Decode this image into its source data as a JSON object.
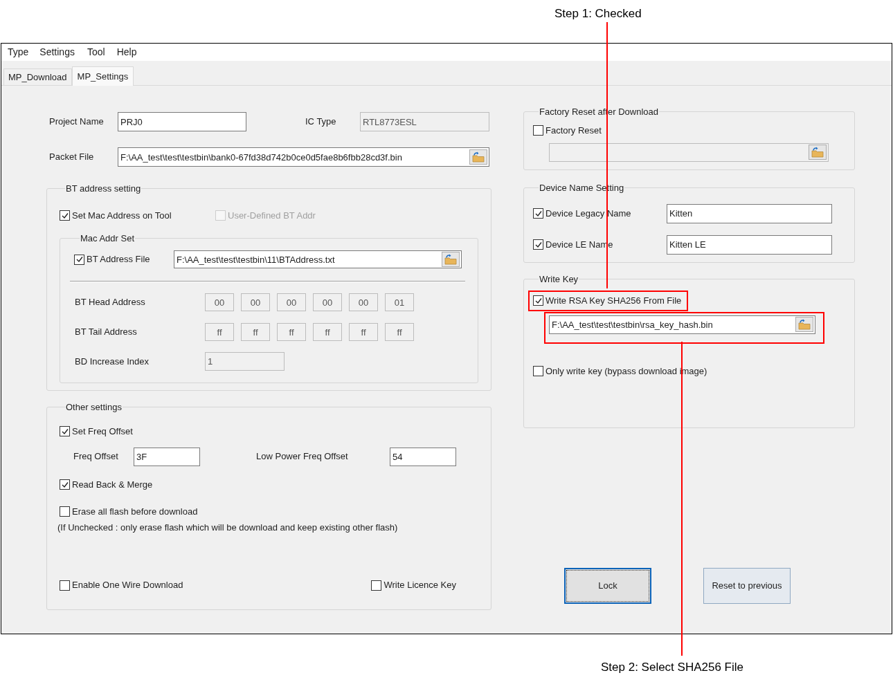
{
  "menu": [
    "Type",
    "Settings",
    "Tool",
    "Help"
  ],
  "tabs": [
    {
      "label": "MP_Download",
      "selected": false
    },
    {
      "label": "MP_Settings",
      "selected": true
    }
  ],
  "project_name": {
    "label": "Project Name",
    "value": "PRJ0",
    "disabled": false
  },
  "ic_type": {
    "label": "IC Type",
    "value": "RTL8773ESL",
    "disabled": true
  },
  "packet_file": {
    "label": "Packet File",
    "value": "F:\\AA_test\\test\\testbin\\bank0-67fd38d742b0ce0d5fae8b6fbb28cd3f.bin",
    "disabled": false,
    "browse": true
  },
  "bt_address_setting": {
    "title": "BT address setting",
    "set_mac": {
      "label": "Set Mac Address on Tool",
      "checked": true,
      "disabled": false
    },
    "user_defined": {
      "label": "User-Defined BT Addr",
      "checked": false,
      "disabled": true
    },
    "mac_addr_set": {
      "title": "Mac Addr Set",
      "bt_address_file": {
        "label": "BT Address File",
        "checked": true,
        "disabled": false
      },
      "file": {
        "value": "F:\\AA_test\\test\\testbin\\11\\BTAddress.txt",
        "disabled": false,
        "browse": true
      },
      "head": {
        "label": "BT Head Address",
        "bytes": [
          "00",
          "00",
          "00",
          "00",
          "00",
          "01"
        ],
        "disabled": true
      },
      "tail": {
        "label": "BT Tail Address",
        "bytes": [
          "ff",
          "ff",
          "ff",
          "ff",
          "ff",
          "ff"
        ],
        "disabled": true
      },
      "increase": {
        "label": "BD Increase Index",
        "value": "1",
        "disabled": true
      }
    }
  },
  "other_settings": {
    "title": "Other settings",
    "set_freq": {
      "label": "Set Freq Offset",
      "checked": true,
      "disabled": false
    },
    "freq_offset": {
      "label": "Freq Offset",
      "value": "3F",
      "disabled": false
    },
    "low_power": {
      "label": "Low Power Freq Offset",
      "value": "54",
      "disabled": false
    },
    "read_back": {
      "label": "Read Back & Merge",
      "checked": true,
      "disabled": false
    },
    "erase_all": {
      "label": "Erase all flash before download",
      "checked": false,
      "disabled": false
    },
    "erase_note": "(If Unchecked : only erase flash which will be download and keep existing other flash)",
    "one_wire": {
      "label": "Enable One Wire Download",
      "checked": false,
      "disabled": false
    },
    "licence": {
      "label": "Write Licence Key",
      "checked": false,
      "disabled": false
    }
  },
  "factory_reset": {
    "title": "Factory Reset after Download",
    "checkbox": {
      "label": "Factory Reset",
      "checked": false,
      "disabled": false
    },
    "file": {
      "disabled": true,
      "browse": true
    }
  },
  "device_name": {
    "title": "Device Name Setting",
    "legacy": {
      "checkbox": {
        "label": "Device Legacy Name",
        "checked": true,
        "disabled": false
      },
      "field": {
        "value": "Kitten",
        "disabled": false
      }
    },
    "le": {
      "checkbox": {
        "label": "Device LE Name",
        "checked": true,
        "disabled": false
      },
      "field": {
        "value": "Kitten LE",
        "disabled": false
      }
    }
  },
  "write_key": {
    "title": "Write Key",
    "rsa": {
      "label": "Write RSA Key SHA256 From File",
      "checked": true,
      "disabled": false
    },
    "file": {
      "value": "F:\\AA_test\\test\\testbin\\rsa_key_hash.bin",
      "disabled": false,
      "browse": true
    },
    "only_write": {
      "label": "Only write key (bypass download image)",
      "checked": false,
      "disabled": false
    }
  },
  "buttons": [
    {
      "label": "Lock",
      "focused": true
    },
    {
      "label": "Reset to previous",
      "focused": false
    }
  ],
  "annotations": [
    {
      "label": "Step 1: Checked"
    },
    {
      "label": "Step 2: Select SHA256 File"
    }
  ]
}
